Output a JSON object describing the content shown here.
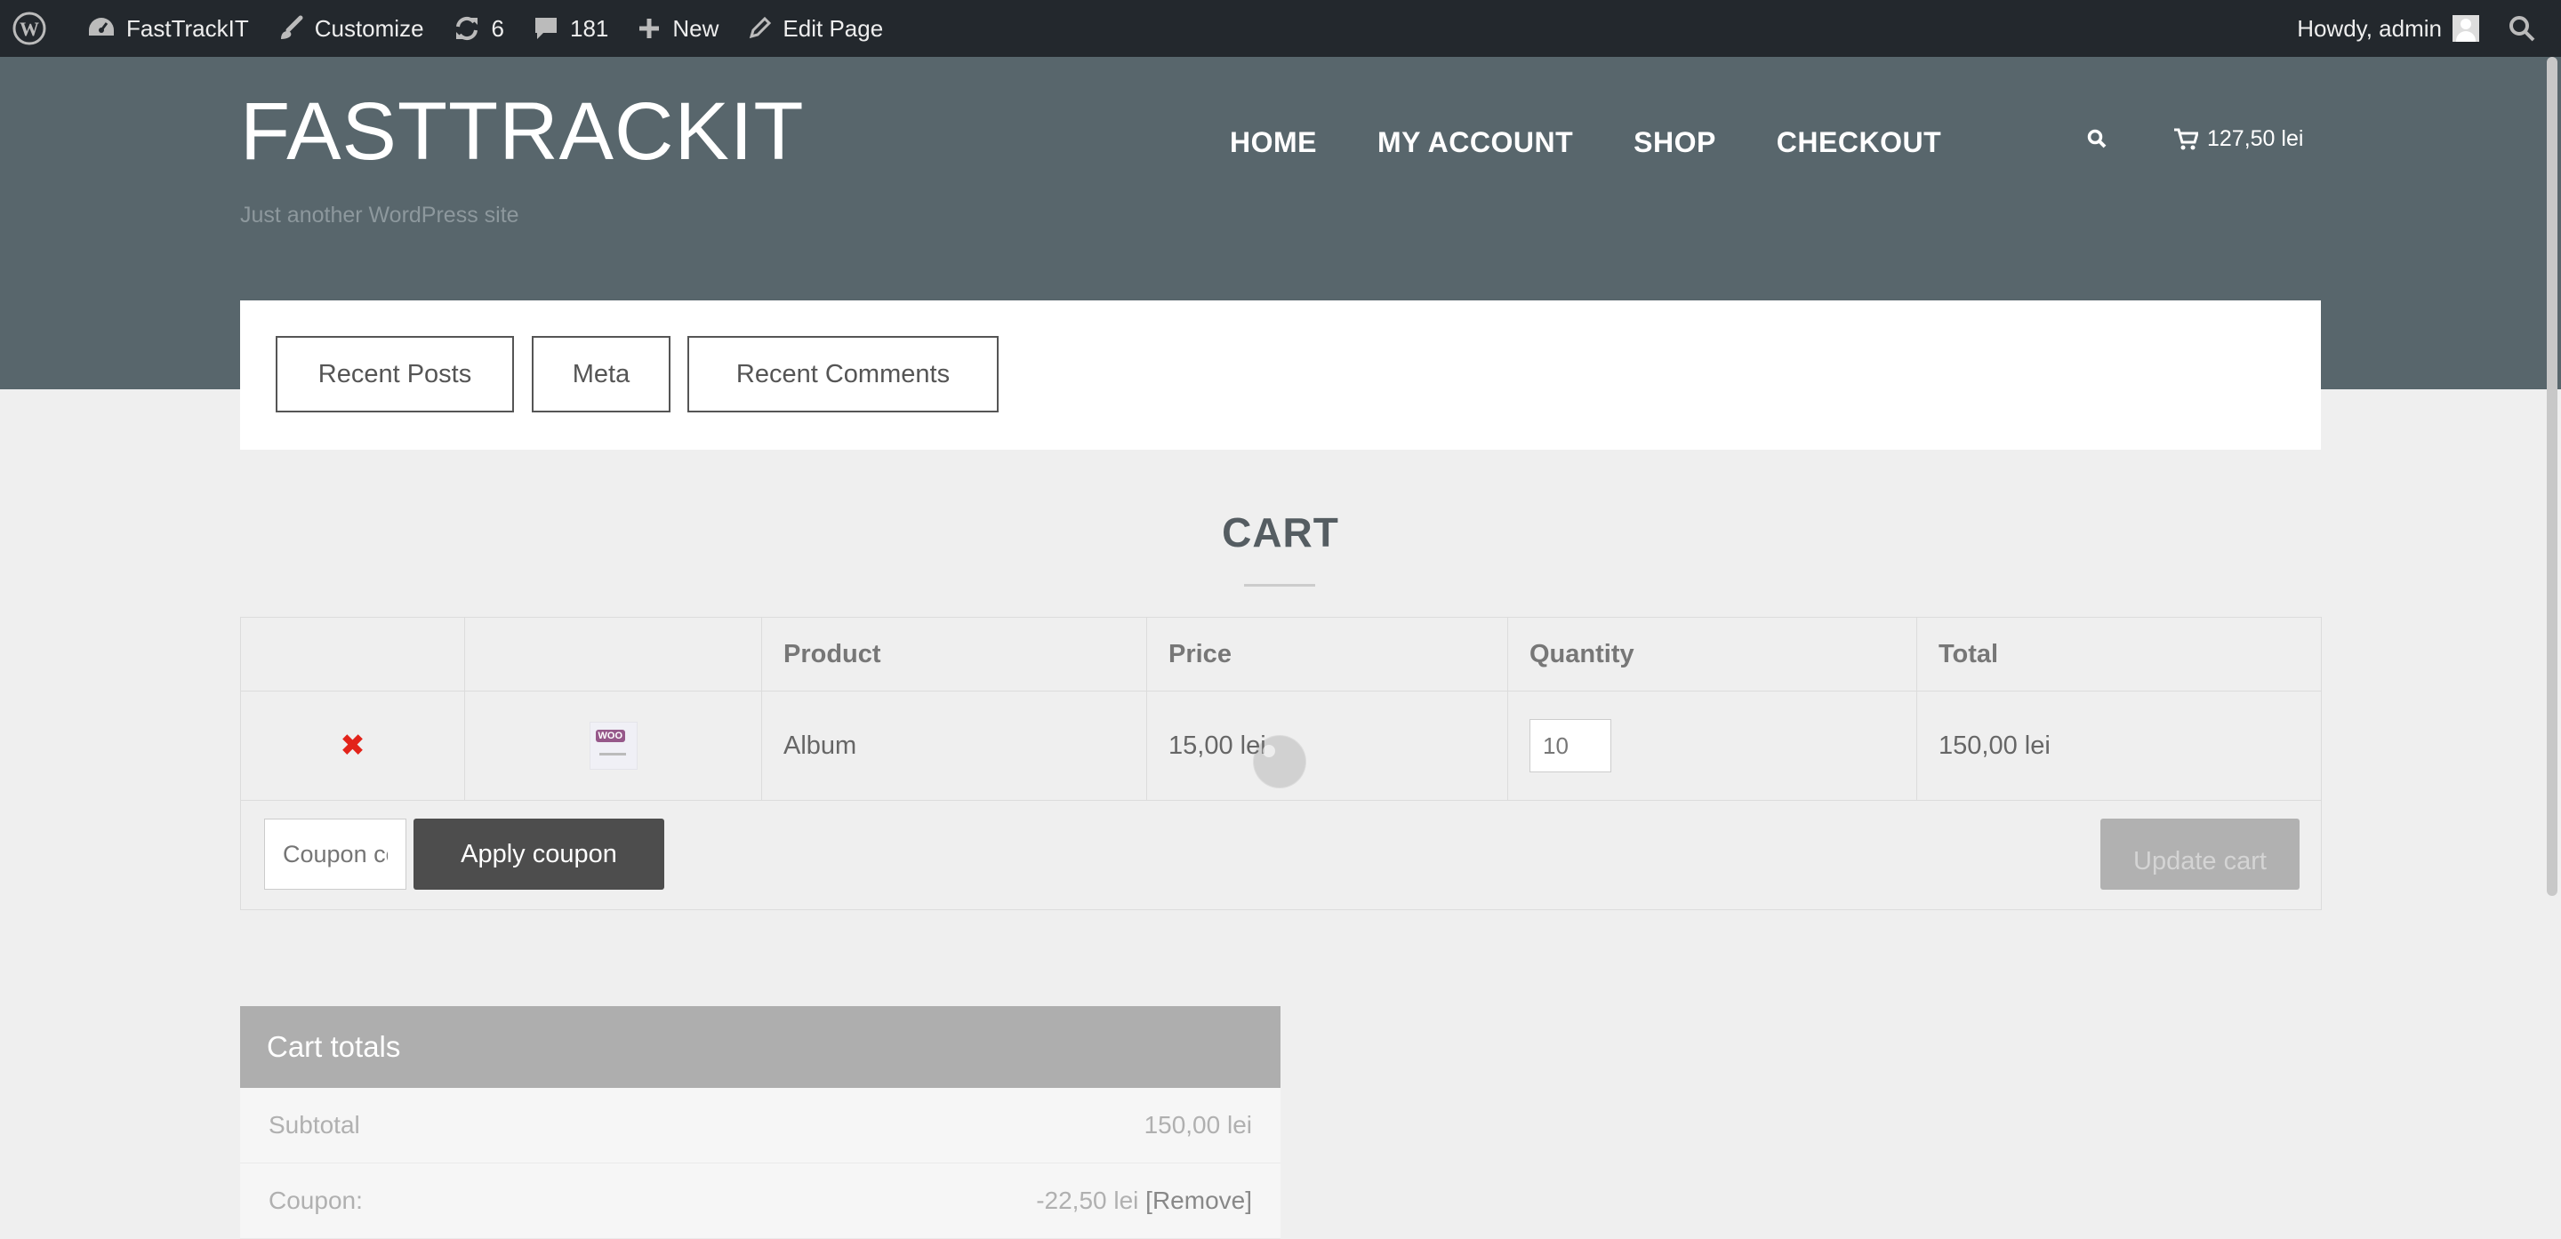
{
  "adminbar": {
    "site_name": "FastTrackIT",
    "customize": "Customize",
    "updates_count": "6",
    "comments_count": "181",
    "new_label": "New",
    "edit_page": "Edit Page",
    "howdy": "Howdy, admin"
  },
  "header": {
    "site_title": "FASTTRACKIT",
    "tagline": "Just another WordPress site",
    "nav": [
      "HOME",
      "MY ACCOUNT",
      "SHOP",
      "CHECKOUT"
    ],
    "cart_total": "127,50 lei"
  },
  "widget_tabs": [
    "Recent Posts",
    "Meta",
    "Recent Comments"
  ],
  "cart": {
    "title": "CART",
    "columns": [
      "",
      "",
      "Product",
      "Price",
      "Quantity",
      "Total"
    ],
    "items": [
      {
        "remove": "✖",
        "product": "Album",
        "price": "15,00 lei",
        "quantity": "10",
        "total": "150,00 lei"
      }
    ],
    "coupon_placeholder": "Coupon code",
    "apply_coupon": "Apply coupon",
    "update_cart": "Update cart"
  },
  "totals": {
    "heading": "Cart totals",
    "subtotal_label": "Subtotal",
    "subtotal_value": "150,00 lei",
    "coupon_label": "Coupon:",
    "coupon_value": "-22,50 lei",
    "coupon_remove": "[Remove]"
  }
}
